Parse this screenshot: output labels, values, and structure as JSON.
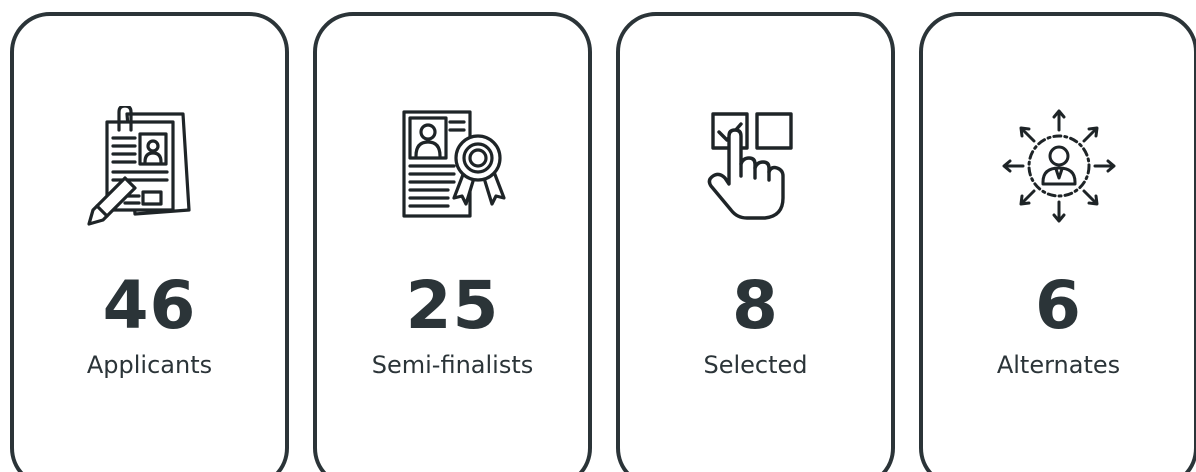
{
  "stats": [
    {
      "icon": "resume-clipboard-icon",
      "count": "46",
      "label": "Applicants"
    },
    {
      "icon": "certificate-award-icon",
      "count": "25",
      "label": "Semi-finalists"
    },
    {
      "icon": "checkbox-select-icon",
      "count": "8",
      "label": "Selected"
    },
    {
      "icon": "candidate-options-icon",
      "count": "6",
      "label": "Alternates"
    }
  ],
  "colors": {
    "ink": "#2b3438",
    "background": "#ffffff"
  }
}
